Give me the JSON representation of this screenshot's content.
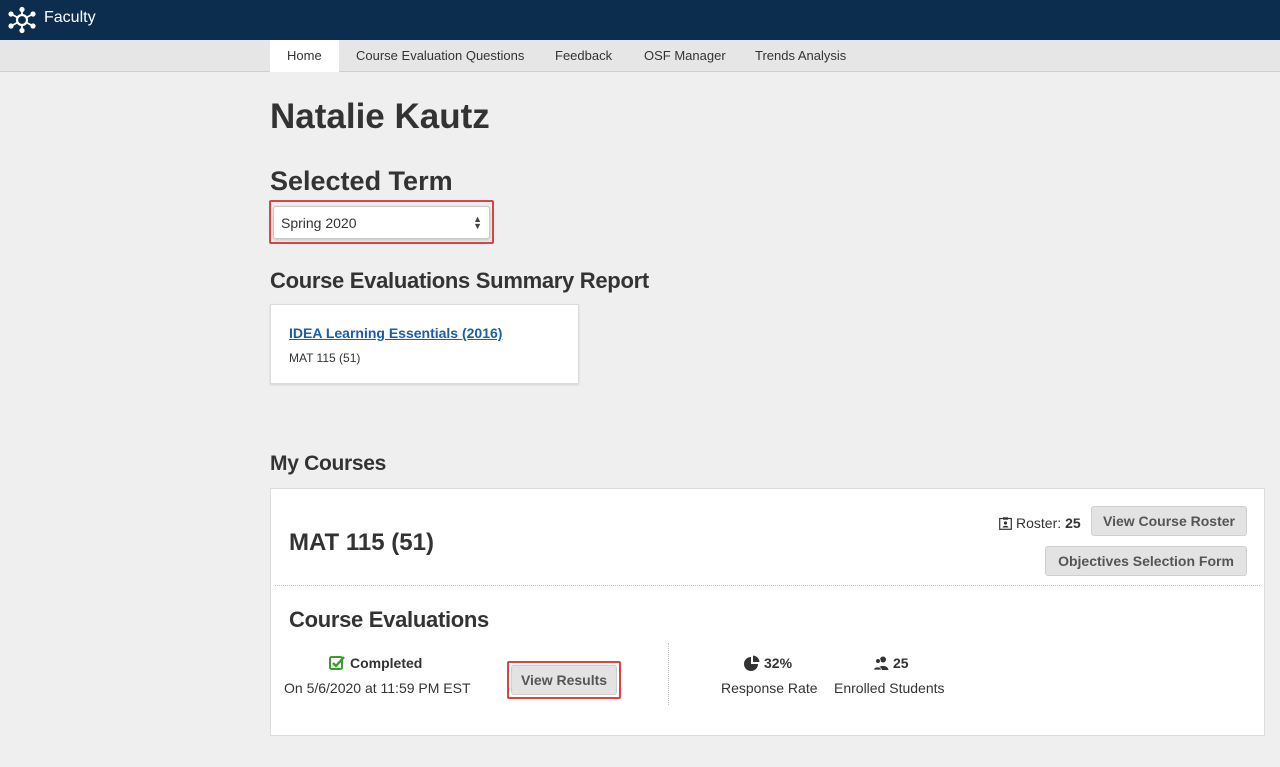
{
  "header": {
    "app_title": "Faculty",
    "logo_icon": "network-logo-icon"
  },
  "nav": {
    "tabs": [
      {
        "label": "Home",
        "active": true
      },
      {
        "label": "Course Evaluation Questions",
        "active": false
      },
      {
        "label": "Feedback",
        "active": false
      },
      {
        "label": "OSF Manager",
        "active": false
      },
      {
        "label": "Trends Analysis",
        "active": false
      }
    ]
  },
  "page": {
    "user_name": "Natalie Kautz",
    "selected_term_heading": "Selected Term",
    "term_select": {
      "value": "Spring 2020"
    },
    "summary_heading": "Course Evaluations Summary Report",
    "summary_card": {
      "link": "IDEA Learning Essentials (2016)",
      "course": "MAT 115 (51)"
    },
    "my_courses_heading": "My Courses"
  },
  "course": {
    "title": "MAT 115 (51)",
    "roster_label": "Roster:",
    "roster_count": "25",
    "view_roster_button": "View Course Roster",
    "objectives_button": "Objectives Selection Form",
    "evaluations_heading": "Course Evaluations",
    "status": "Completed",
    "completed_on": "On 5/6/2020 at 11:59 PM EST",
    "view_results_button": "View Results",
    "response_rate_value": "32%",
    "response_rate_label": "Response Rate",
    "enrolled_value": "25",
    "enrolled_label": "Enrolled Students"
  },
  "colors": {
    "header_bg": "#0d2d4f",
    "link": "#1a5ea8",
    "highlight": "#d94545",
    "success": "#3c9a2f"
  }
}
